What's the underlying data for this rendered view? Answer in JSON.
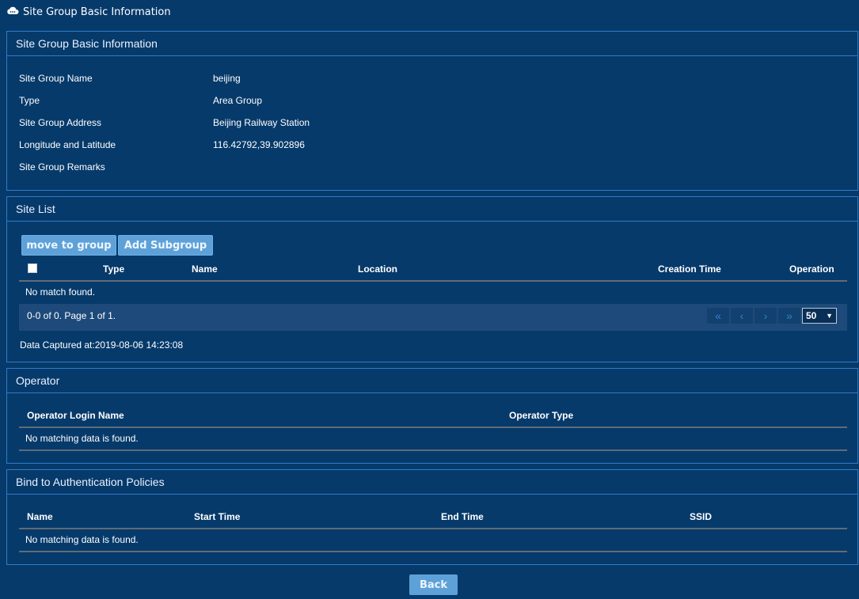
{
  "page": {
    "title": "Site Group Basic Information"
  },
  "basic_info": {
    "heading": "Site Group Basic Information",
    "rows": [
      {
        "label": "Site Group Name",
        "value": "beijing"
      },
      {
        "label": "Type",
        "value": "Area Group"
      },
      {
        "label": "Site Group Address",
        "value": "Beijing Railway Station"
      },
      {
        "label": "Longitude and Latitude",
        "value": "116.42792,39.902896"
      },
      {
        "label": "Site Group Remarks",
        "value": ""
      }
    ]
  },
  "site_list": {
    "heading": "Site List",
    "buttons": {
      "move_to_group": "move to group",
      "add_subgroup": "Add Subgroup"
    },
    "columns": [
      "Type",
      "Name",
      "Location",
      "Creation Time",
      "Operation"
    ],
    "empty_text": "No match found.",
    "pager": {
      "summary": "0-0 of 0. Page 1 of 1.",
      "page_size": "50"
    },
    "captured": "Data Captured at:2019-08-06 14:23:08"
  },
  "operator": {
    "heading": "Operator",
    "columns": [
      "Operator Login Name",
      "Operator Type"
    ],
    "empty_text": "No matching data is found."
  },
  "auth_policies": {
    "heading": "Bind to Authentication Policies",
    "columns": [
      "Name",
      "Start Time",
      "End Time",
      "SSID"
    ],
    "empty_text": "No matching data is found."
  },
  "footer": {
    "back_label": "Back"
  }
}
